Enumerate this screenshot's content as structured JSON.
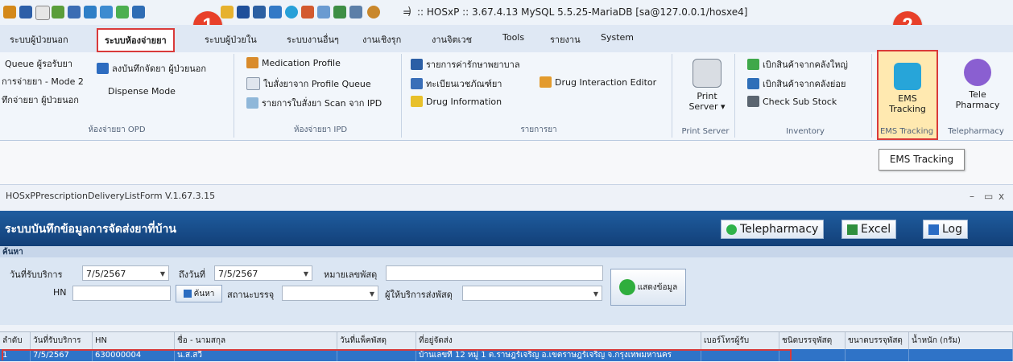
{
  "titlebar": {
    "title": ":: HOSxP :: 3.67.4.13 MySQL 5.5.25-MariaDB [sa@127.0.0.1/hosxe4]",
    "dropdown_glyph": "=",
    "close_glyph": ")",
    "quick_access_icons": [
      "users-icon",
      "save-icon",
      "document-icon",
      "user-edit-icon",
      "edit-icon",
      "edit-icon",
      "image-icon",
      "calendar-icon",
      "table-icon",
      "pill-icon",
      "user-icon",
      "list-icon",
      "chart-icon",
      "clock-icon",
      "home-icon",
      "report-icon",
      "id-card-icon",
      "photo-icon",
      "person-icon"
    ]
  },
  "callouts": {
    "one": "1",
    "two": "2"
  },
  "menu_tabs": [
    "ระบบผู้ป่วยนอก",
    "ระบบห้องจ่ายยา",
    "ระบบผู้ป่วยใน",
    "ระบบงานอื่นๆ",
    "งานเชิงรุก",
    "งานจิตเวช",
    "Tools",
    "รายงาน",
    "System"
  ],
  "ribbon": {
    "opd": {
      "caption": "ห้องจ่ายยา OPD",
      "queue": "Queue ผู้รอรับยา",
      "mode2": "การจ่ายยา - Mode 2",
      "dispense_opd": "ทึกจ่ายยา ผู้ป่วยนอก",
      "record_opd": "ลงบันทึกจัดยา ผู้ป่วยนอก",
      "dispense_mode": "Dispense Mode"
    },
    "ipd": {
      "caption": "ห้องจ่ายยา IPD",
      "med_profile": "Medication Profile",
      "order_queue": "ใบสั่งยาจาก Profile Queue",
      "scan_ipd": "รายการใบสั่งยา Scan จาก IPD"
    },
    "drug_list": {
      "caption": "รายการยา",
      "hospital_fee": "รายการค่ารักษาพยาบาล",
      "supplies": "ทะเบียนเวชภัณฑ์ยา",
      "drug_info": "Drug Information",
      "interaction": "Drug Interaction Editor"
    },
    "print_server": {
      "caption": "Print Server",
      "label": "Print\nServer ▾"
    },
    "inventory": {
      "caption": "Inventory",
      "main_stock": "เบิกสินค้าจากคลังใหญ่",
      "sub_stock": "เบิกสินค้าจากคลังย่อย",
      "check": "Check Sub Stock"
    },
    "ems": {
      "caption": "EMS Tracking",
      "label": "EMS\nTracking"
    },
    "tele": {
      "caption": "Telepharmacy",
      "label": "Tele\nPharmacy"
    },
    "tooltip": "EMS Tracking"
  },
  "subwindow": {
    "title": "HOSxPPrescriptionDeliveryListForm V.1.67.3.15",
    "controls": [
      "–",
      "▭",
      "x"
    ],
    "form_title": "ระบบบันทึกข้อมูลการจัดส่งยาที่บ้าน",
    "buttons": {
      "telepharmacy": "Telepharmacy",
      "excel": "Excel",
      "log": "Log"
    },
    "search_label": "ค้นหา"
  },
  "search": {
    "date_from_label": "วันที่รับบริการ",
    "date_from": "7/5/2567",
    "date_to_label": "ถึงวันที่",
    "date_to": "7/5/2567",
    "parcel_label": "หมายเลขพัสดุ",
    "parcel_value": "",
    "hn_label": "HN",
    "hn_value": "",
    "search_button": "ค้นหา",
    "package_label": "สถานะบรรจุ",
    "package_value": "",
    "courier_label": "ผู้ให้บริการส่งพัสดุ",
    "courier_value": "",
    "show_button": "แสดงข้อมูล"
  },
  "table": {
    "columns": [
      "ลำดับ",
      "วันที่รับบริการ",
      "HN",
      "ชื่อ - นามสกุล",
      "วันที่แพ็คพัสดุ",
      "ที่อยู่จัดส่ง",
      "เบอร์โทรผู้รับ",
      "ชนิดบรรจุพัสดุ",
      "ขนาดบรรจุพัสดุ",
      "น้ำหนัก (กรัม)"
    ],
    "rows": [
      {
        "no": "1",
        "date": "7/5/2567",
        "hn": "630000004",
        "name": "น.ส.สวี",
        "pack_date": "",
        "address": "บ้านเลขที่ 12 หมู่ 1 ต.ราษฎร์เจริญ อ.เขตราษฎร์เจริญ จ.กรุงเทพมหานคร",
        "phone": "",
        "pkg_type": "",
        "pkg_size": "",
        "weight": ""
      }
    ]
  },
  "colors": {
    "header_blue": "#1a4f8c",
    "selected_row": "#2f73c7",
    "highlight_red": "#d93a3a",
    "ems_active": "#ffe9b0"
  }
}
